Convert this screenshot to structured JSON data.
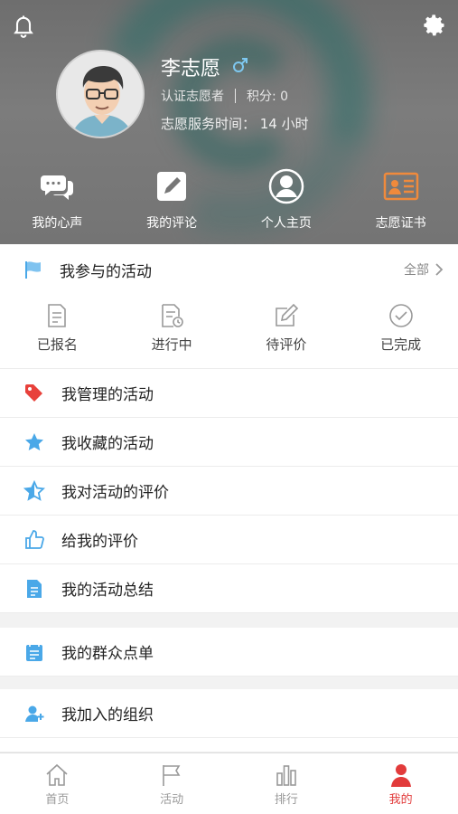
{
  "header": {
    "name": "李志愿",
    "certification": "认证志愿者",
    "points": "积分: 0",
    "service_hours": "志愿服务时间：  14 小时"
  },
  "quick_actions": [
    {
      "label": "我的心声",
      "icon": "chat-bubbles-icon"
    },
    {
      "label": "我的评论",
      "icon": "edit-icon"
    },
    {
      "label": "个人主页",
      "icon": "profile-icon"
    },
    {
      "label": "志愿证书",
      "icon": "certificate-icon"
    }
  ],
  "participation": {
    "title": "我参与的活动",
    "all_label": "全部",
    "statuses": [
      {
        "label": "已报名",
        "icon": "registered-icon"
      },
      {
        "label": "进行中",
        "icon": "in-progress-icon"
      },
      {
        "label": "待评价",
        "icon": "to-review-icon"
      },
      {
        "label": "已完成",
        "icon": "completed-icon"
      }
    ]
  },
  "menu": [
    {
      "label": "我管理的活动",
      "icon": "tag-icon",
      "color": "#e8413b"
    },
    {
      "label": "我收藏的活动",
      "icon": "star-icon",
      "color": "#4aa8e8"
    },
    {
      "label": "我对活动的评价",
      "icon": "star-half-icon",
      "color": "#4aa8e8"
    },
    {
      "label": "给我的评价",
      "icon": "thumbs-up-icon",
      "color": "#4aa8e8"
    },
    {
      "label": "我的活动总结",
      "icon": "document-icon",
      "color": "#4aa8e8"
    },
    {
      "label": "我的群众点单",
      "icon": "calendar-icon",
      "color": "#4aa8e8"
    },
    {
      "label": "我加入的组织",
      "icon": "add-user-icon",
      "color": "#4aa8e8"
    }
  ],
  "tabs": [
    {
      "label": "首页",
      "icon": "home-icon"
    },
    {
      "label": "活动",
      "icon": "flag-icon"
    },
    {
      "label": "排行",
      "icon": "bar-chart-icon"
    },
    {
      "label": "我的",
      "icon": "person-icon"
    }
  ],
  "colors": {
    "accent": "#e23b3b",
    "menu_icon": "#4aa8e8",
    "certificate": "#f08a3c"
  }
}
